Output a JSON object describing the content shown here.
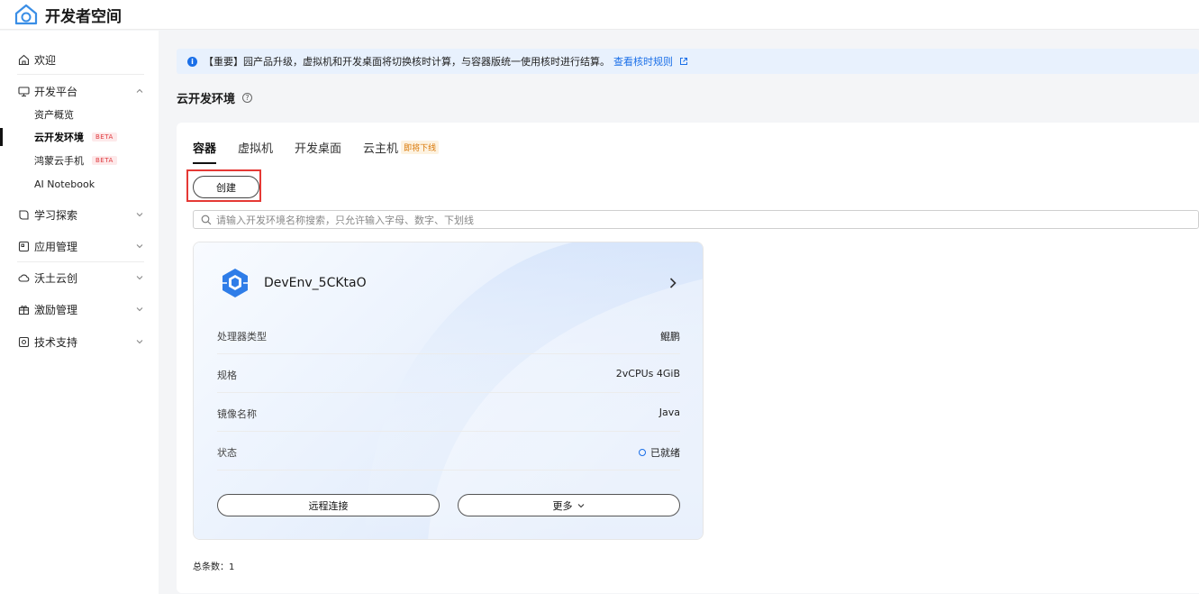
{
  "app": {
    "title": "开发者空间"
  },
  "sidebar": {
    "welcome": {
      "label": "欢迎",
      "icon": "home-icon"
    },
    "dev_platform": {
      "label": "开发平台",
      "icon": "monitor-icon",
      "children": [
        {
          "label": "资产概览"
        },
        {
          "label": "云开发环境",
          "badge": "BETA",
          "active": true
        },
        {
          "label": "鸿蒙云手机",
          "badge": "BETA"
        },
        {
          "label": "AI Notebook"
        }
      ]
    },
    "groups": [
      {
        "label": "学习探索",
        "icon": "learn-icon"
      },
      {
        "label": "应用管理",
        "icon": "app-icon"
      },
      {
        "label": "沃土云创",
        "icon": "cloud-icon"
      },
      {
        "label": "激励管理",
        "icon": "gift-icon"
      },
      {
        "label": "技术支持",
        "icon": "support-icon"
      }
    ]
  },
  "notice": {
    "text": "【重要】园产品升级，虚拟机和开发桌面将切换核时计算，与容器版统一使用核时进行结算。",
    "link": "查看核时规则"
  },
  "page": {
    "title": "云开发环境"
  },
  "tabs": [
    {
      "label": "容器",
      "active": true
    },
    {
      "label": "虚拟机"
    },
    {
      "label": "开发桌面"
    },
    {
      "label": "云主机",
      "tag": "即将下线"
    }
  ],
  "toolbar": {
    "create_label": "创建"
  },
  "search": {
    "placeholder": "请输入开发环境名称搜索，只允许输入字母、数字、下划线"
  },
  "card": {
    "name": "DevEnv_5CKtaO",
    "rows": [
      {
        "key": "处理器类型",
        "value": "鲲鹏"
      },
      {
        "key": "规格",
        "value": "2vCPUs 4GiB"
      },
      {
        "key": "镜像名称",
        "value": "Java"
      },
      {
        "key": "状态",
        "value": "已就绪"
      }
    ],
    "connect_label": "远程连接",
    "more_label": "更多"
  },
  "footer": {
    "total": "总条数：1"
  },
  "colors": {
    "accent": "#1a6fe8",
    "highlight": "#e53935",
    "beta": "#e0393e"
  }
}
